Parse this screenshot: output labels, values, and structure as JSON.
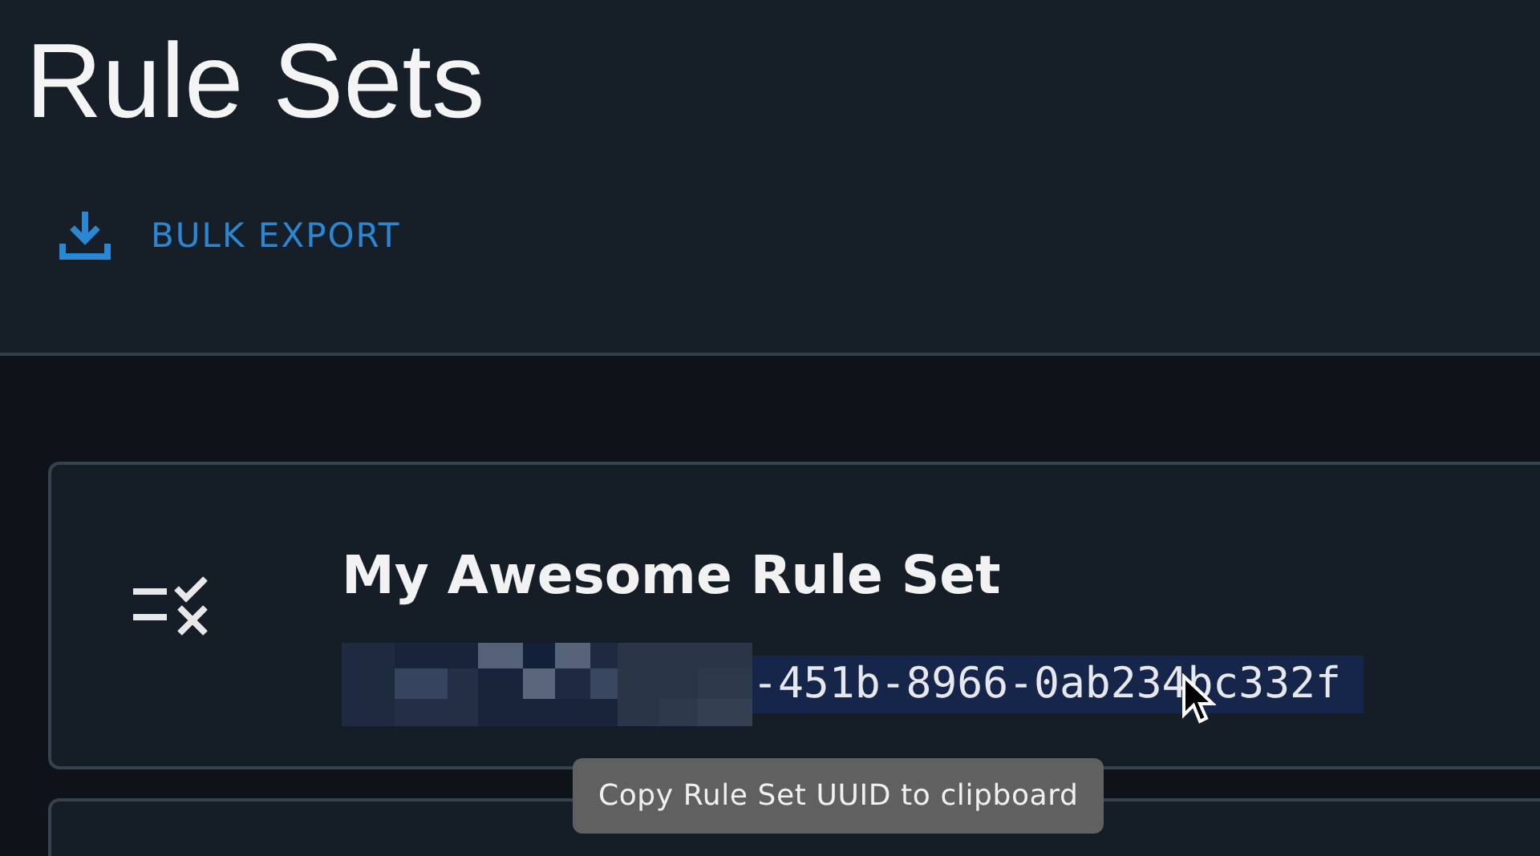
{
  "page_title": "Rule Sets",
  "toolbar": {
    "button": "BULK EXPORT"
  },
  "rule_sets": [
    {
      "name": "My Awesome Rule Set",
      "uuid_visible": "-451b-8966-0ab234bc332f",
      "uuid_selected": true
    }
  ],
  "tooltip": "Copy Rule Set UUID to clipboard"
}
